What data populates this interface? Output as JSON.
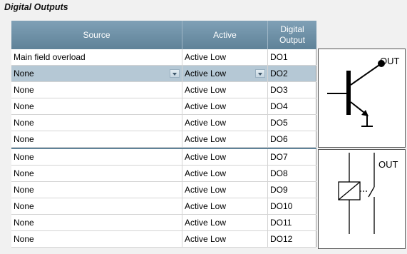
{
  "section": {
    "title": "Digital Outputs"
  },
  "header": {
    "source": "Source",
    "active": "Active",
    "output_line1": "Digital",
    "output_line2": "Output"
  },
  "rows_top": [
    {
      "source": "Main field overload",
      "active": "Active Low",
      "output": "DO1",
      "selected": false
    },
    {
      "source": "None",
      "active": "Active Low",
      "output": "DO2",
      "selected": true
    },
    {
      "source": "None",
      "active": "Active Low",
      "output": "DO3",
      "selected": false
    },
    {
      "source": "None",
      "active": "Active Low",
      "output": "DO4",
      "selected": false
    },
    {
      "source": "None",
      "active": "Active Low",
      "output": "DO5",
      "selected": false
    },
    {
      "source": "None",
      "active": "Active Low",
      "output": "DO6",
      "selected": false
    }
  ],
  "rows_bottom": [
    {
      "source": "None",
      "active": "Active Low",
      "output": "DO7"
    },
    {
      "source": "None",
      "active": "Active Low",
      "output": "DO8"
    },
    {
      "source": "None",
      "active": "Active Low",
      "output": "DO9"
    },
    {
      "source": "None",
      "active": "Active Low",
      "output": "DO10"
    },
    {
      "source": "None",
      "active": "Active Low",
      "output": "DO11"
    },
    {
      "source": "None",
      "active": "Active Low",
      "output": "DO12"
    }
  ],
  "symbols": {
    "transistor_label": "OUT",
    "relay_label": "OUT"
  },
  "colors": {
    "header": "#6f92a8",
    "selected_row": "#b5c8d5"
  }
}
